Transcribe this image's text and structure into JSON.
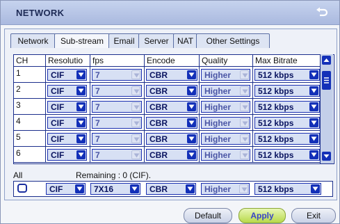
{
  "window": {
    "title": "NETWORK"
  },
  "tabs": [
    "Network",
    "Sub-stream",
    "Email",
    "Server",
    "NAT",
    "Other Settings"
  ],
  "active_tab": "Sub-stream",
  "columns": [
    "CH",
    "Resolutio",
    "fps",
    "Encode",
    "Quality",
    "Max Bitrate"
  ],
  "rows": [
    {
      "ch": "1",
      "resolution": "CIF",
      "fps": "7",
      "encode": "CBR",
      "quality": "Higher",
      "bitrate": "512 kbps"
    },
    {
      "ch": "2",
      "resolution": "CIF",
      "fps": "7",
      "encode": "CBR",
      "quality": "Higher",
      "bitrate": "512 kbps"
    },
    {
      "ch": "3",
      "resolution": "CIF",
      "fps": "7",
      "encode": "CBR",
      "quality": "Higher",
      "bitrate": "512 kbps"
    },
    {
      "ch": "4",
      "resolution": "CIF",
      "fps": "7",
      "encode": "CBR",
      "quality": "Higher",
      "bitrate": "512 kbps"
    },
    {
      "ch": "5",
      "resolution": "CIF",
      "fps": "7",
      "encode": "CBR",
      "quality": "Higher",
      "bitrate": "512 kbps"
    },
    {
      "ch": "6",
      "resolution": "CIF",
      "fps": "7",
      "encode": "CBR",
      "quality": "Higher",
      "bitrate": "512 kbps"
    }
  ],
  "all": {
    "label": "All",
    "remaining": "Remaining : 0 (CIF).",
    "resolution": "CIF",
    "fps": "7X16",
    "encode": "CBR",
    "quality": "Higher",
    "bitrate": "512 kbps"
  },
  "buttons": {
    "default": "Default",
    "apply": "Apply",
    "exit": "Exit"
  },
  "colors": {
    "accent": "#1330b8",
    "apply_bg": "#c7e36a",
    "title_bg": "#b3c2e6"
  },
  "icons": {
    "back": "return-arrow-icon",
    "dropdown": "chevron-down-icon"
  }
}
